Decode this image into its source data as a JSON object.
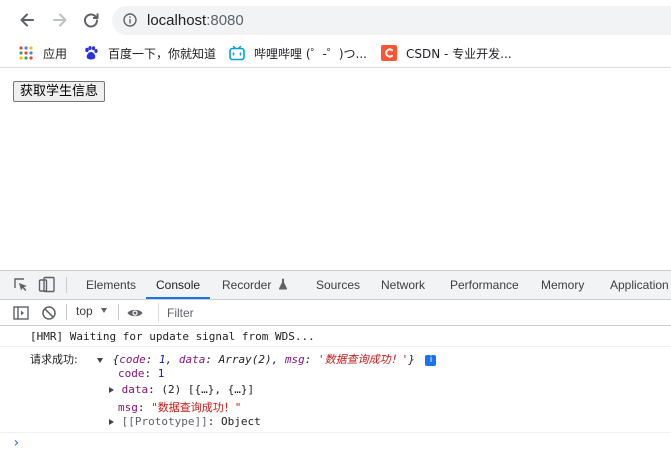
{
  "browser": {
    "url_host": "localhost",
    "url_port": ":8080",
    "bookmarks": [
      {
        "label": "应用",
        "icon": "apps-grid-icon"
      },
      {
        "label": "百度一下，你就知道",
        "icon": "baidu-paw-icon"
      },
      {
        "label": "哔哩哔哩 (゜-゜)つ...",
        "icon": "bilibili-tv-icon"
      },
      {
        "label": "CSDN - 专业开发...",
        "icon": "csdn-c-icon"
      }
    ]
  },
  "page": {
    "button_label": "获取学生信息"
  },
  "devtools": {
    "tabs": [
      "Elements",
      "Console",
      "Recorder",
      "Sources",
      "Network",
      "Performance",
      "Memory",
      "Application"
    ],
    "active_tab": "Console",
    "context": "top",
    "filter_placeholder": "Filter",
    "console": {
      "hmr_message": "[HMR] Waiting for update signal from WDS...",
      "log_prefix": "请求成功:",
      "summary": {
        "open": "{",
        "code_key": "code",
        "code_val": "1",
        "data_key": "data",
        "data_val": "Array(2)",
        "msg_key": "msg",
        "msg_val": "'数据查询成功！'",
        "close": "}"
      },
      "props": [
        {
          "key": "code",
          "value": "1"
        },
        {
          "key": "data",
          "value": "(2) [{…}, {…}]"
        },
        {
          "key": "msg",
          "value": "\"数据查询成功！\""
        },
        {
          "key": "[[Prototype]]",
          "value": "Object"
        }
      ],
      "prompt": "›"
    },
    "colors": {
      "accent": "#1a73e8",
      "key": "#881280",
      "number": "#1a1aa6",
      "string": "#c41a16"
    }
  }
}
